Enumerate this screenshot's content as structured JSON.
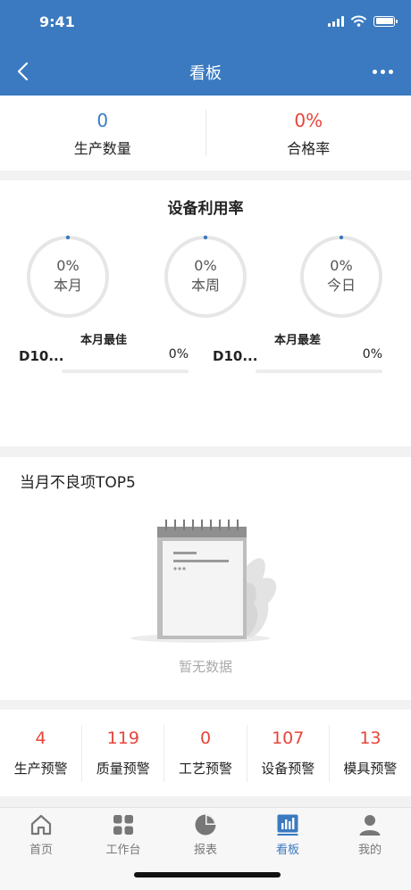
{
  "status_bar": {
    "time": "9:41"
  },
  "nav": {
    "title": "看板"
  },
  "summary": [
    {
      "value": "0",
      "label": "生产数量",
      "color": "#3b7ac0"
    },
    {
      "value": "0%",
      "label": "合格率",
      "color": "#e8443a"
    }
  ],
  "utilization": {
    "title": "设备利用率",
    "gauges": [
      {
        "percent": "0%",
        "label": "本月",
        "value": 0
      },
      {
        "percent": "0%",
        "label": "本周",
        "value": 0
      },
      {
        "percent": "0%",
        "label": "今日",
        "value": 0
      }
    ],
    "best": {
      "title": "本月最佳",
      "name": "D10...",
      "percent": "0%",
      "value": 0
    },
    "worst": {
      "title": "本月最差",
      "name": "D10...",
      "percent": "0%",
      "value": 0
    }
  },
  "defects": {
    "title": "当月不良项TOP5",
    "empty_text": "暂无数据"
  },
  "alerts": [
    {
      "value": "4",
      "label": "生产预警"
    },
    {
      "value": "119",
      "label": "质量预警"
    },
    {
      "value": "0",
      "label": "工艺预警"
    },
    {
      "value": "107",
      "label": "设备预警"
    },
    {
      "value": "13",
      "label": "模具预警"
    }
  ],
  "tabs": [
    {
      "label": "首页",
      "icon": "home-icon",
      "active": false
    },
    {
      "label": "工作台",
      "icon": "grid-icon",
      "active": false
    },
    {
      "label": "报表",
      "icon": "pie-chart-icon",
      "active": false
    },
    {
      "label": "看板",
      "icon": "bar-chart-icon",
      "active": true
    },
    {
      "label": "我的",
      "icon": "person-icon",
      "active": false
    }
  ],
  "colors": {
    "accent": "#3b7ac0",
    "alert": "#e8443a",
    "tab_inactive": "#777777",
    "gauge_track": "#e6e6e6"
  }
}
